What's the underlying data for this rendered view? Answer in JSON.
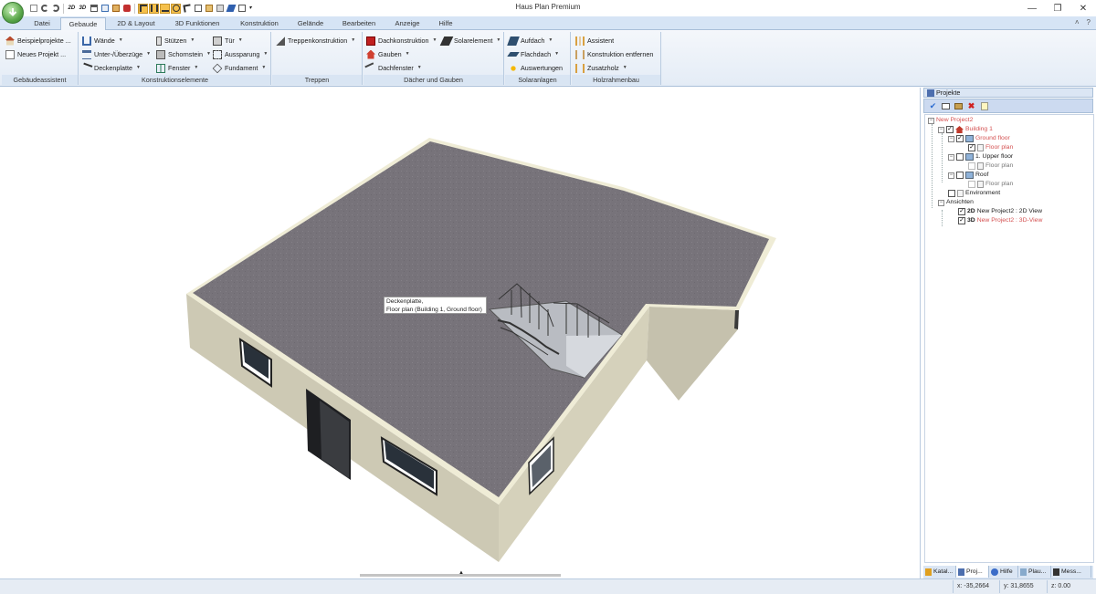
{
  "window": {
    "title": "Haus Plan Premium",
    "minimize": "—",
    "restore": "❐",
    "close": "✕"
  },
  "tabs": [
    {
      "label": "Datei"
    },
    {
      "label": "Gebaude"
    },
    {
      "label": "2D & Layout"
    },
    {
      "label": "3D Funktionen"
    },
    {
      "label": "Konstruktion"
    },
    {
      "label": "Gelände"
    },
    {
      "label": "Bearbeiten"
    },
    {
      "label": "Anzeige"
    },
    {
      "label": "Hilfe"
    }
  ],
  "tabbar_right": {
    "collapse": "˄",
    "help": "?"
  },
  "ribbon": {
    "gebaudeassistent": {
      "label": "Gebäudeassistent",
      "items": [
        "Beispielprojekte ...",
        "Neues Projekt ..."
      ]
    },
    "konstruktionselemente": {
      "label": "Konstruktionselemente",
      "col1": [
        "Wände",
        "Unter-/Überzüge",
        "Deckenplatte"
      ],
      "col2": [
        "Stützen",
        "Schornstein",
        "Fenster"
      ],
      "col3": [
        "Tür",
        "Aussparung",
        "Fundament"
      ]
    },
    "treppen": {
      "label": "Treppen",
      "items": [
        "Treppenkonstruktion"
      ]
    },
    "dacher": {
      "label": "Dächer und Gauben",
      "col1": [
        "Dachkonstruktion",
        "Gauben",
        "Dachfenster"
      ],
      "col2": [
        "Solarelement"
      ]
    },
    "solaranlagen": {
      "label": "Solaranlagen",
      "items": [
        "Aufdach",
        "Flachdach",
        "Auswertungen"
      ]
    },
    "holzrahmenbau": {
      "label": "Holzrahmenbau",
      "items": [
        "Assistent",
        "Konstruktion entfernen",
        "Zusatzholz"
      ]
    }
  },
  "viewport": {
    "tooltip_line1": "Deckenplatte,",
    "tooltip_line2": "Floor plan (Building 1, Ground floor)",
    "colors": {
      "roof": "#77737a",
      "wall": "#cdc9b4",
      "cap": "#efecd6"
    }
  },
  "projects_panel": {
    "title": "Projekte",
    "tree": {
      "project": "New Project2",
      "building": "Building 1",
      "ground_floor": "Ground floor",
      "ground_floor_plan": "Floor plan",
      "upper_floor": "1. Upper floor",
      "upper_floor_plan": "Floor plan",
      "roof": "Roof",
      "roof_plan": "Floor plan",
      "environment": "Environment",
      "views": "Ansichten",
      "view_2d_tag": "2D",
      "view_2d": "New Project2 : 2D View",
      "view_3d_tag": "3D",
      "view_3d": "New Project2 : 3D-View"
    },
    "bottom_tabs": [
      "Katal...",
      "Proj...",
      "Hilfe",
      "Plau...",
      "Mess..."
    ]
  },
  "status": {
    "x": "x: -35,2664",
    "y": "y: 31,8655",
    "z": "z: 0.00"
  }
}
